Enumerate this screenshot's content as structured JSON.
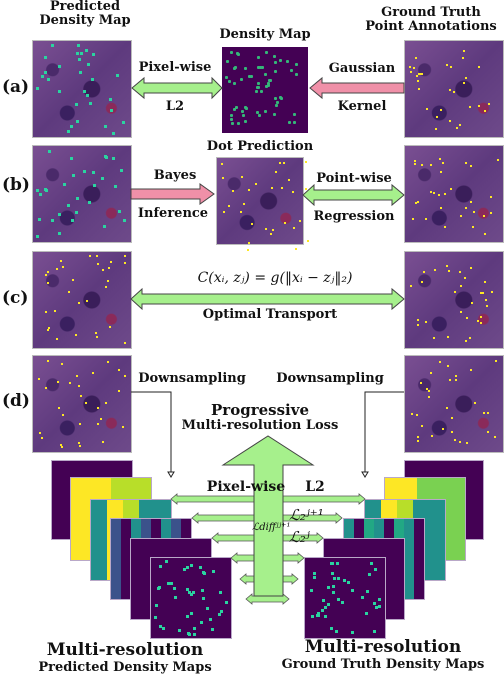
{
  "headers": {
    "predicted": [
      "Predicted",
      "Density Map"
    ],
    "density_map": "Density Map",
    "ground_truth": [
      "Ground Truth",
      "Point Annotations"
    ],
    "dot_prediction": "Dot Prediction"
  },
  "rows": [
    {
      "label": "(a)",
      "left_arrow_top": "Pixel-wise",
      "left_arrow_bottom": "L2",
      "right_arrow_top": "Gaussian",
      "right_arrow_bottom": "Kernel"
    },
    {
      "label": "(b)",
      "left_arrow_top": "Bayes",
      "left_arrow_bottom": "Inference",
      "right_arrow_top": "Point-wise",
      "right_arrow_bottom": "Regression"
    },
    {
      "label": "(c)",
      "formula": "C(xᵢ, zⱼ) = g(‖xᵢ − zⱼ‖₂)",
      "arrow_bottom": "Optimal Transport"
    },
    {
      "label": "(d)",
      "left_down": "Downsampling",
      "right_down": "Downsampling",
      "center_title": "Progressive",
      "center_subtitle": "Multi-resolution Loss"
    }
  ],
  "multires": {
    "pixelwise": "Pixel-wise",
    "l2": "L2",
    "loss_j1": "ℒ₂ʲ⁺¹",
    "loss_j": "ℒ₂ʲ",
    "loss_diff": "ℒdiffʲʲ⁺¹",
    "left_caption": [
      "Multi-resolution",
      "Predicted Density Maps"
    ],
    "right_caption": [
      "Multi-resolution",
      "Ground Truth Density Maps"
    ]
  },
  "colors": {
    "green_arrow": "#a6f08c",
    "pink_arrow": "#f090a8",
    "viridis_dark": "#440154",
    "viridis_yellow": "#fde725"
  }
}
